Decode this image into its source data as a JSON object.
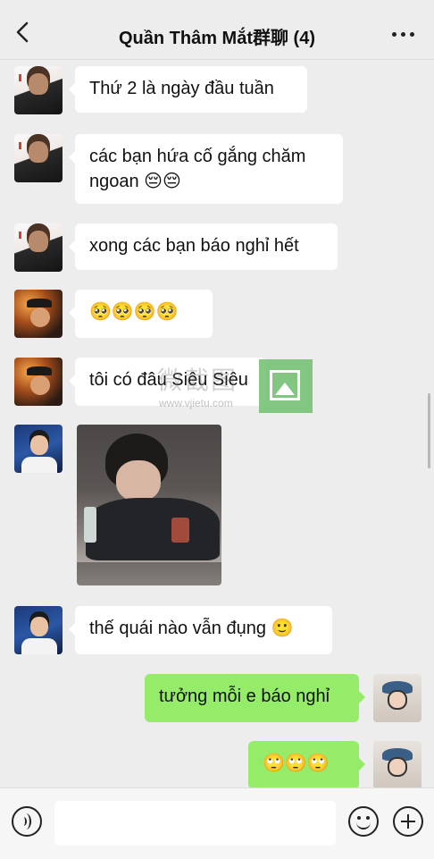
{
  "header": {
    "title": "Quần Thâm Mắt群聊 (4)",
    "back_icon": "chevron-left-icon",
    "more_icon": "more-dots-icon"
  },
  "messages": [
    {
      "side": "left",
      "text": "Thứ 2 là ngày đầu tuần"
    },
    {
      "side": "left",
      "text": "các bạn hứa cố gắng chăm ngoan 😔😔"
    },
    {
      "side": "left",
      "text": "xong các bạn báo nghỉ hết"
    },
    {
      "side": "left",
      "text": "🥺🥺🥺🥺"
    },
    {
      "side": "left",
      "text": "tôi có đâu Siêu Siêu"
    },
    {
      "side": "left",
      "type": "image"
    },
    {
      "side": "left",
      "text": "thế quái nào vẫn đụng 🙂"
    },
    {
      "side": "right",
      "text": "tưởng mỗi e báo nghỉ"
    },
    {
      "side": "right",
      "text": "🙄🙄🙄"
    }
  ],
  "watermark": {
    "text": "微截图",
    "url": "www.vjietu.com"
  },
  "composer": {
    "voice_icon": "voice-icon",
    "emoji_icon": "emoji-icon",
    "plus_icon": "plus-icon"
  }
}
